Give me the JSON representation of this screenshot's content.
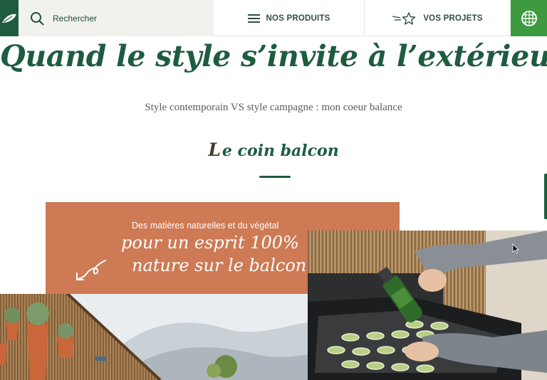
{
  "header": {
    "search": {
      "label": "Rechercher",
      "icon": "search-icon"
    },
    "nav": [
      {
        "label": "NOS PRODUITS",
        "icon": "menu-icon"
      },
      {
        "label": "VOS PROJETS",
        "icon": "star-icon"
      }
    ],
    "logo_icon": "leaf-logo-icon",
    "basket_icon": "basket-icon"
  },
  "hero": {
    "title": "Quand le style s’invite à l’extérieur",
    "subtitle": "Style contemporain VS style campagne : mon coeur balance"
  },
  "section": {
    "title_cap": "L",
    "title_rest": "e coin balcon"
  },
  "banner": {
    "small": "Des matières naturelles et du végétal",
    "line1": "pour un esprit 100%",
    "line2": "nature sur le balcon"
  },
  "colors": {
    "brand_green": "#1e5c40",
    "accent_green": "#3d9a3f",
    "terracotta": "#cd7a55"
  }
}
